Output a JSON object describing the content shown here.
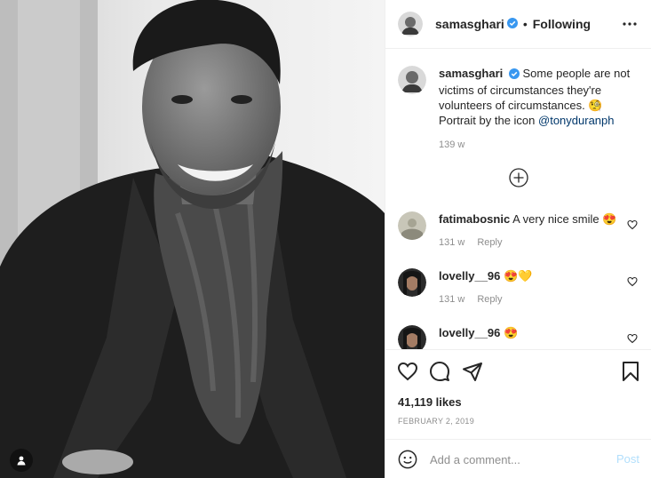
{
  "post": {
    "author": "samasghari",
    "follow_status": "Following",
    "separator": "•",
    "caption_text": "Some people are not victims of circumstances they're volunteers of circumstances. 🧐 Portrait by the icon",
    "caption_mention": "@tonyduranph",
    "caption_age": "139 w"
  },
  "comments": [
    {
      "user": "fatimabosnic",
      "text": "A very nice smile 😍",
      "age": "131 w",
      "reply": "Reply"
    },
    {
      "user": "lovelly__96",
      "text": "😍💛",
      "age": "131 w",
      "reply": "Reply"
    },
    {
      "user": "lovelly__96",
      "text": "😍",
      "age": "",
      "reply": ""
    }
  ],
  "footer": {
    "likes": "41,119 likes",
    "date": "FEBRUARY 2, 2019",
    "comment_placeholder": "Add a comment...",
    "post_label": "Post"
  },
  "icons": {
    "photo_tag": "user-tag-icon",
    "more": "more-options-icon",
    "verified": "verified-badge-icon",
    "load_more": "load-more-comments-icon",
    "like": "heart-icon",
    "comment": "comment-icon",
    "share": "share-icon",
    "save": "bookmark-icon",
    "emoji": "emoji-icon"
  },
  "colors": {
    "verified": "#3897f0",
    "mention": "#00376b",
    "muted": "#8e8e8e",
    "post_disabled": "#b2dffc"
  }
}
